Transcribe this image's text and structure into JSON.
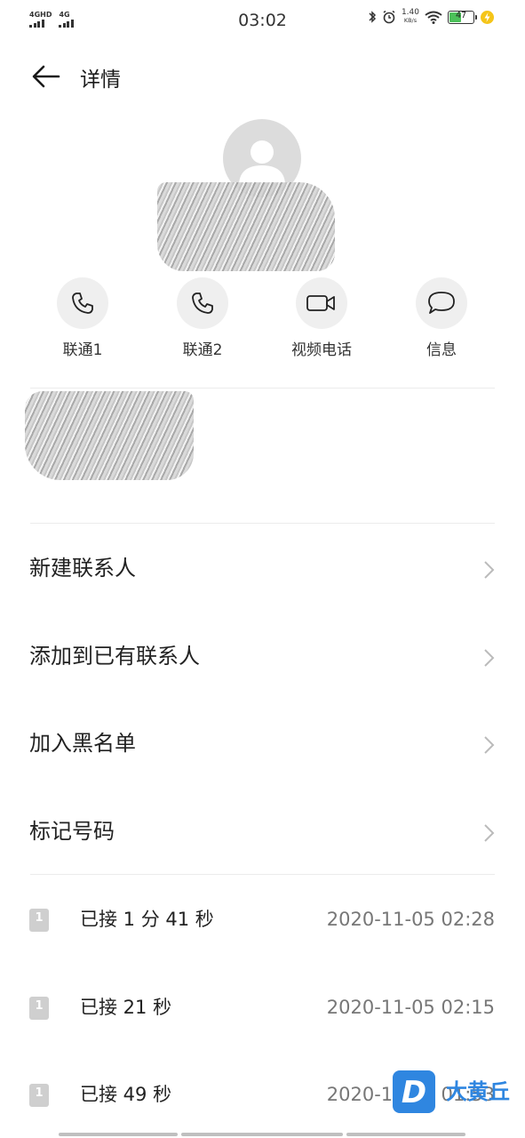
{
  "status_bar": {
    "sim1": "4GHD",
    "sim2": "4G",
    "time": "03:02",
    "speed_value": "1.40",
    "speed_unit": "KB/s",
    "battery": "47"
  },
  "header": {
    "title": "详情"
  },
  "actions": [
    {
      "label": "联通1",
      "icon": "phone-icon"
    },
    {
      "label": "联通2",
      "icon": "phone-icon"
    },
    {
      "label": "视频电话",
      "icon": "video-camera-icon"
    },
    {
      "label": "信息",
      "icon": "message-bubble-icon"
    }
  ],
  "menu": [
    {
      "label": "新建联系人"
    },
    {
      "label": "添加到已有联系人"
    },
    {
      "label": "加入黑名单"
    },
    {
      "label": "标记号码"
    }
  ],
  "call_log": [
    {
      "status": "已接 1 分 41 秒",
      "time": "2020-11-05 02:28",
      "sim": "1"
    },
    {
      "status": "已接 21 秒",
      "time": "2020-11-05 02:15",
      "sim": "1"
    },
    {
      "status": "已接 49 秒",
      "time": "2020-11-05 01:53",
      "sim": "1"
    }
  ],
  "watermark": {
    "logo_letter": "D",
    "text": "大黄丘"
  },
  "colors": {
    "accent_blue": "#2f86e0",
    "battery_green": "#4cc15a",
    "icon_gray": "#cfcfcf"
  }
}
